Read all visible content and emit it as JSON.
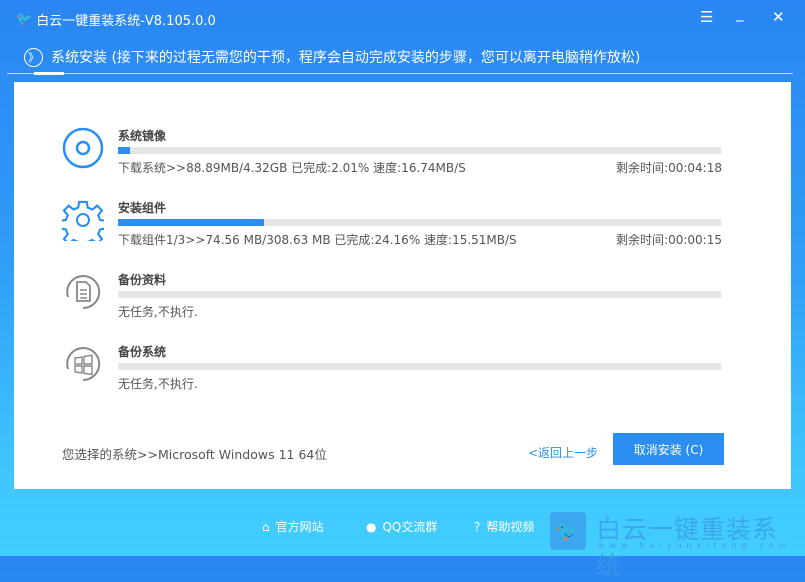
{
  "window": {
    "title": "白云一键重装系统-V8.105.0.0",
    "menu_icon": "menu-icon",
    "minimize_icon": "minimize-icon",
    "close_icon": "close-icon"
  },
  "header": {
    "subtitle": "系统安装 (接下来的过程无需您的干预，程序会自动完成安装的步骤，您可以离开电脑稍作放松)"
  },
  "steps": [
    {
      "name": "系统镜像",
      "progress": 2.01,
      "info": "下载系统>>88.89MB/4.32GB 已完成:2.01%  速度:16.74MB/S",
      "remaining": "剩余时间:00:04:18",
      "icon": "disc-icon"
    },
    {
      "name": "安装组件",
      "progress": 24.16,
      "info": "下载组件1/3>>74.56 MB/308.63 MB 已完成:24.16%  速度:15.51MB/S",
      "remaining": "剩余时间:00:00:15",
      "icon": "gear-icon"
    },
    {
      "name": "备份资料",
      "progress": 0,
      "info": "无任务,不执行.",
      "icon": "document-backup-icon"
    },
    {
      "name": "备份系统",
      "progress": 0,
      "info": "无任务,不执行.",
      "icon": "windows-backup-icon"
    }
  ],
  "selected_system": "您选择的系统>>Microsoft Windows 11 64位",
  "back_label": "<返回上一步",
  "cancel_label": "取消安装 (C)",
  "footer": {
    "website": "官方网站",
    "qq": "QQ交流群",
    "help": "帮助视频"
  },
  "logo": {
    "text": "白云一键重装系统",
    "url": "www.baiyunxitong.com"
  },
  "colors": {
    "accent": "#2a8ff0",
    "track": "#e6e6e6"
  }
}
